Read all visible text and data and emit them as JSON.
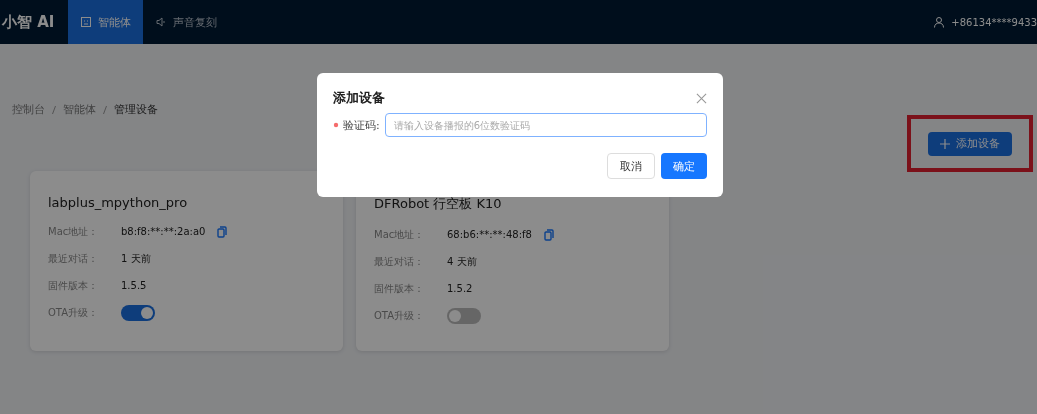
{
  "header": {
    "logo": "小智 AI",
    "tabs": [
      {
        "label": "智能体",
        "selected": true
      },
      {
        "label": "声音复刻",
        "selected": false
      }
    ],
    "user": "+86134****9433"
  },
  "breadcrumb": [
    "控制台",
    "智能体",
    "管理设备"
  ],
  "add_button": {
    "label": "添加设备",
    "highlighted": true
  },
  "devices": [
    {
      "name": "labplus_mpython_pro",
      "fields": [
        {
          "label": "Mac地址：",
          "value": "b8:f8:**:**:2a:a0",
          "copy": true
        },
        {
          "label": "最近对话：",
          "value": "1 天前",
          "copy": false
        },
        {
          "label": "固件版本：",
          "value": "1.5.5",
          "copy": false
        }
      ],
      "ota_label": "OTA升级：",
      "ota_on": true
    },
    {
      "name": "DFRobot 行空板 K10",
      "fields": [
        {
          "label": "Mac地址：",
          "value": "68:b6:**:**:48:f8",
          "copy": true
        },
        {
          "label": "最近对话：",
          "value": "4 天前",
          "copy": false
        },
        {
          "label": "固件版本：",
          "value": "1.5.2",
          "copy": false
        }
      ],
      "ota_label": "OTA升级：",
      "ota_on": false
    }
  ],
  "dialog": {
    "title": "添加设备",
    "field_label": "验证码:",
    "required": true,
    "placeholder": "请输入设备播报的6位数验证码",
    "cancel": "取消",
    "confirm": "确定"
  }
}
